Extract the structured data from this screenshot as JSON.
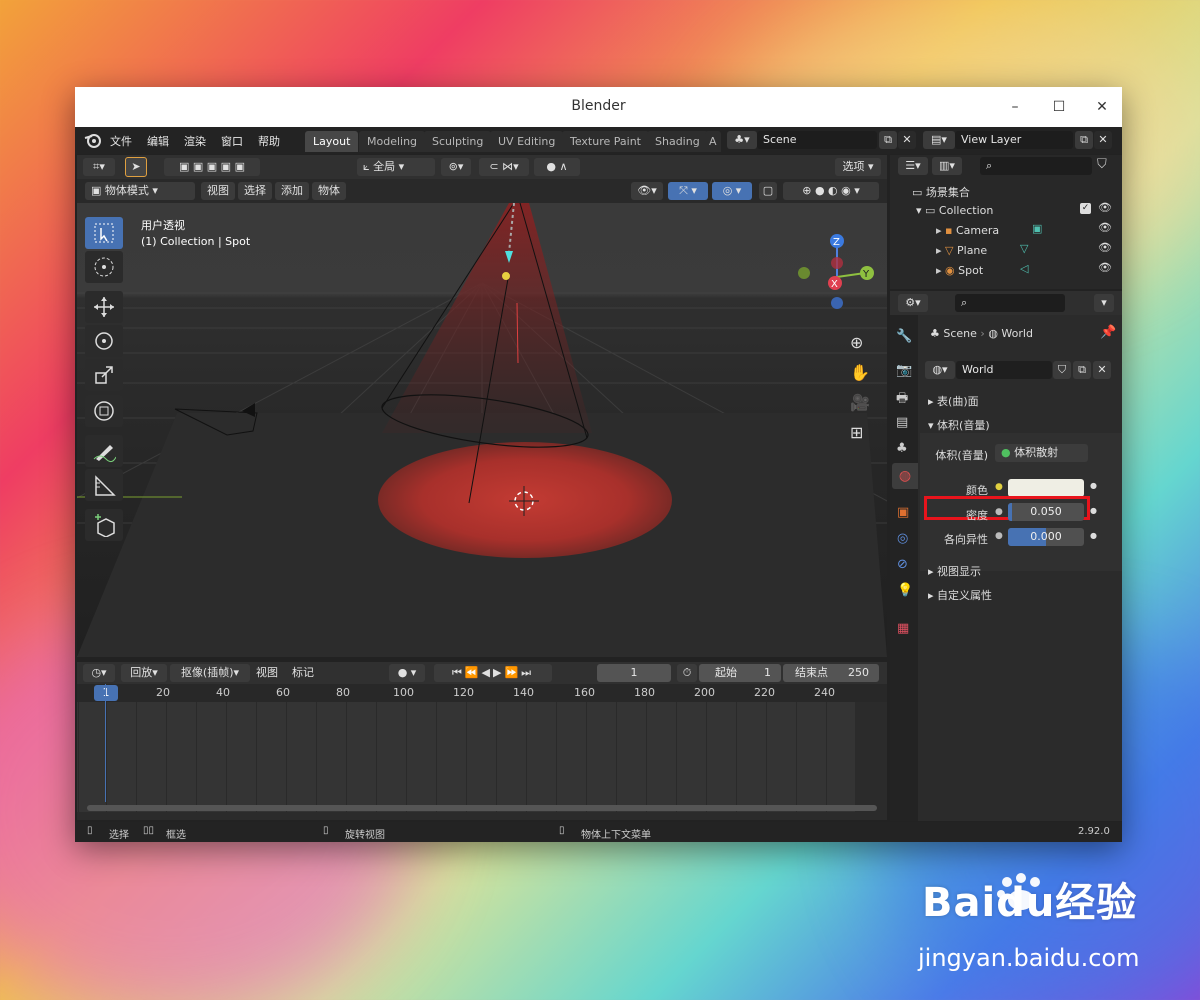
{
  "window": {
    "title": "Blender"
  },
  "menu": [
    "文件",
    "编辑",
    "渲染",
    "窗口",
    "帮助"
  ],
  "workspaces": [
    {
      "label": "Layout",
      "active": true
    },
    {
      "label": "Modeling"
    },
    {
      "label": "Sculpting"
    },
    {
      "label": "UV Editing"
    },
    {
      "label": "Texture Paint"
    },
    {
      "label": "Shading"
    },
    {
      "label": "A"
    }
  ],
  "scene_field": "Scene",
  "viewlayer_field": "View Layer",
  "viewport": {
    "orientation": "全局",
    "options": "选项",
    "mode": "物体模式",
    "menus": [
      "视图",
      "选择",
      "添加",
      "物体"
    ],
    "overlay_title": "用户透视",
    "overlay_sub": "(1) Collection | Spot",
    "gizmo": {
      "z": "Z",
      "y": "Y",
      "x": "X"
    }
  },
  "outliner": {
    "root": "场景集合",
    "collection": "Collection",
    "items": [
      "Camera",
      "Plane",
      "Spot"
    ]
  },
  "properties": {
    "breadcrumb_scene": "Scene",
    "breadcrumb_world": "World",
    "world_name": "World",
    "sections": {
      "surface": "表(曲)面",
      "volume": "体积(音量)",
      "viewport_display": "视图显示",
      "custom_props": "自定义属性"
    },
    "volume_label": "体积(音量)",
    "volume_value": "体积散射",
    "color_label": "颜色",
    "density_label": "密度",
    "density_value": "0.050",
    "density_fraction": 0.05,
    "anisotropy_label": "各向异性",
    "anisotropy_value": "0.000"
  },
  "timeline": {
    "menus": [
      "回放",
      "抠像(插帧)",
      "视图",
      "标记"
    ],
    "current_frame": "1",
    "start_label": "起始",
    "start_value": "1",
    "end_label": "结束点",
    "end_value": "250",
    "ruler": [
      "1",
      "20",
      "40",
      "60",
      "80",
      "100",
      "120",
      "140",
      "160",
      "180",
      "200",
      "220",
      "240"
    ]
  },
  "status": {
    "select": "选择",
    "box_select": "框选",
    "rotate": "旋转视图",
    "context": "物体上下文菜单",
    "version": "2.92.0"
  },
  "watermark": {
    "brand": "Baidu经验",
    "url": "jingyan.baidu.com"
  },
  "colors": {
    "accent": "#4772b3",
    "highlight": "#e8141c",
    "spot": "#b8302a"
  }
}
